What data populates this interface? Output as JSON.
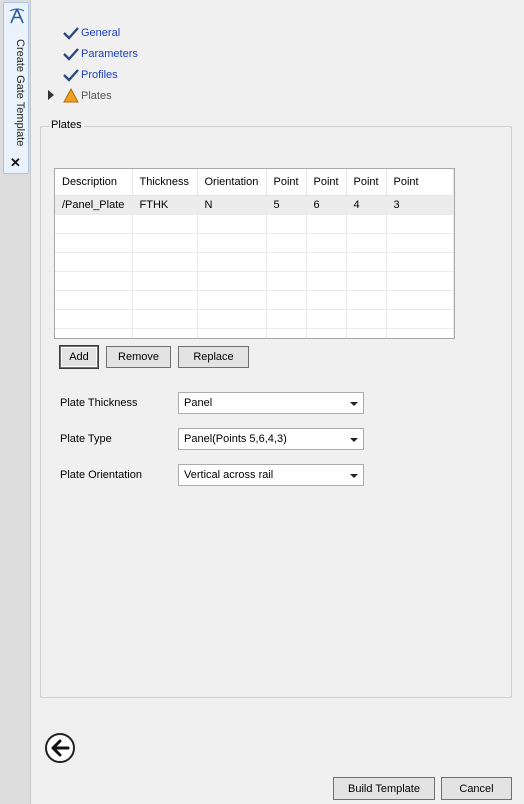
{
  "side_tab": {
    "title": "Create Gate Template",
    "logo_icon": "app-logo-icon",
    "close_glyph": "✕"
  },
  "steps": [
    {
      "label": "General",
      "state": "done"
    },
    {
      "label": "Parameters",
      "state": "done"
    },
    {
      "label": "Profiles",
      "state": "done"
    },
    {
      "label": "Plates",
      "state": "current-warning"
    }
  ],
  "group_title": "Plates",
  "table": {
    "columns": [
      "Description",
      "Thickness",
      "Orientation",
      "Point",
      "Point",
      "Point",
      "Point"
    ],
    "rows": [
      [
        "/Panel_Plate",
        "FTHK",
        "N",
        "5",
        "6",
        "4",
        "3"
      ]
    ]
  },
  "buttons": {
    "add": "Add",
    "remove": "Remove",
    "replace": "Replace",
    "build": "Build Template",
    "cancel": "Cancel"
  },
  "fields": {
    "thickness": {
      "label": "Plate Thickness",
      "value": "Panel"
    },
    "type": {
      "label": "Plate Type",
      "value": "Panel(Points 5,6,4,3)"
    },
    "orientation": {
      "label": "Plate Orientation",
      "value": "Vertical across rail"
    }
  },
  "colors": {
    "link": "#1d3fbb",
    "check": "#2c4a7a",
    "warning": "#f0a020"
  }
}
